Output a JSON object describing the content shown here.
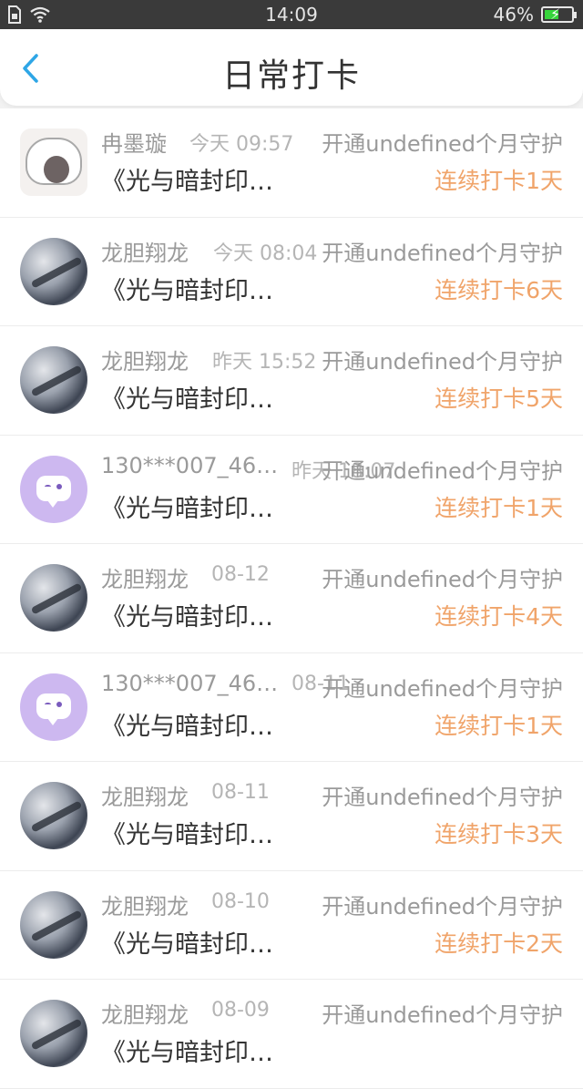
{
  "status_bar": {
    "time": "14:09",
    "battery": "46%",
    "battery_level": 0.46,
    "icons": [
      "sim-icon",
      "wifi-icon",
      "battery-charging-icon"
    ]
  },
  "header": {
    "title": "日常打卡",
    "back_icon": "chevron-left-icon"
  },
  "rows": [
    {
      "avatar": "cat",
      "name": "冉墨璇",
      "time": "今天 09:57",
      "subscription": "开通undefined个月守护",
      "book": "《光与暗封印…",
      "streak": "连续打卡1天"
    },
    {
      "avatar": "dragon",
      "name": "龙胆翔龙",
      "time": "今天 08:04",
      "subscription": "开通undefined个月守护",
      "book": "《光与暗封印…",
      "streak": "连续打卡6天"
    },
    {
      "avatar": "dragon",
      "name": "龙胆翔龙",
      "time": "昨天 15:52",
      "subscription": "开通undefined个月守护",
      "book": "《光与暗封印…",
      "streak": "连续打卡5天"
    },
    {
      "avatar": "bubble",
      "name": "130***007_46…",
      "time": "昨天 18:07",
      "subscription": "开通undefined个月守护",
      "book": "《光与暗封印…",
      "streak": "连续打卡1天"
    },
    {
      "avatar": "dragon",
      "name": "龙胆翔龙",
      "time": "08-12",
      "subscription": "开通undefined个月守护",
      "book": "《光与暗封印…",
      "streak": "连续打卡4天"
    },
    {
      "avatar": "bubble",
      "name": "130***007_46…",
      "time": "08-11",
      "subscription": "开通undefined个月守护",
      "book": "《光与暗封印…",
      "streak": "连续打卡1天"
    },
    {
      "avatar": "dragon",
      "name": "龙胆翔龙",
      "time": "08-11",
      "subscription": "开通undefined个月守护",
      "book": "《光与暗封印…",
      "streak": "连续打卡3天"
    },
    {
      "avatar": "dragon",
      "name": "龙胆翔龙",
      "time": "08-10",
      "subscription": "开通undefined个月守护",
      "book": "《光与暗封印…",
      "streak": "连续打卡2天"
    },
    {
      "avatar": "dragon",
      "name": "龙胆翔龙",
      "time": "08-09",
      "subscription": "开通undefined个月守护",
      "book": "《光与暗封印…",
      "streak": ""
    }
  ]
}
